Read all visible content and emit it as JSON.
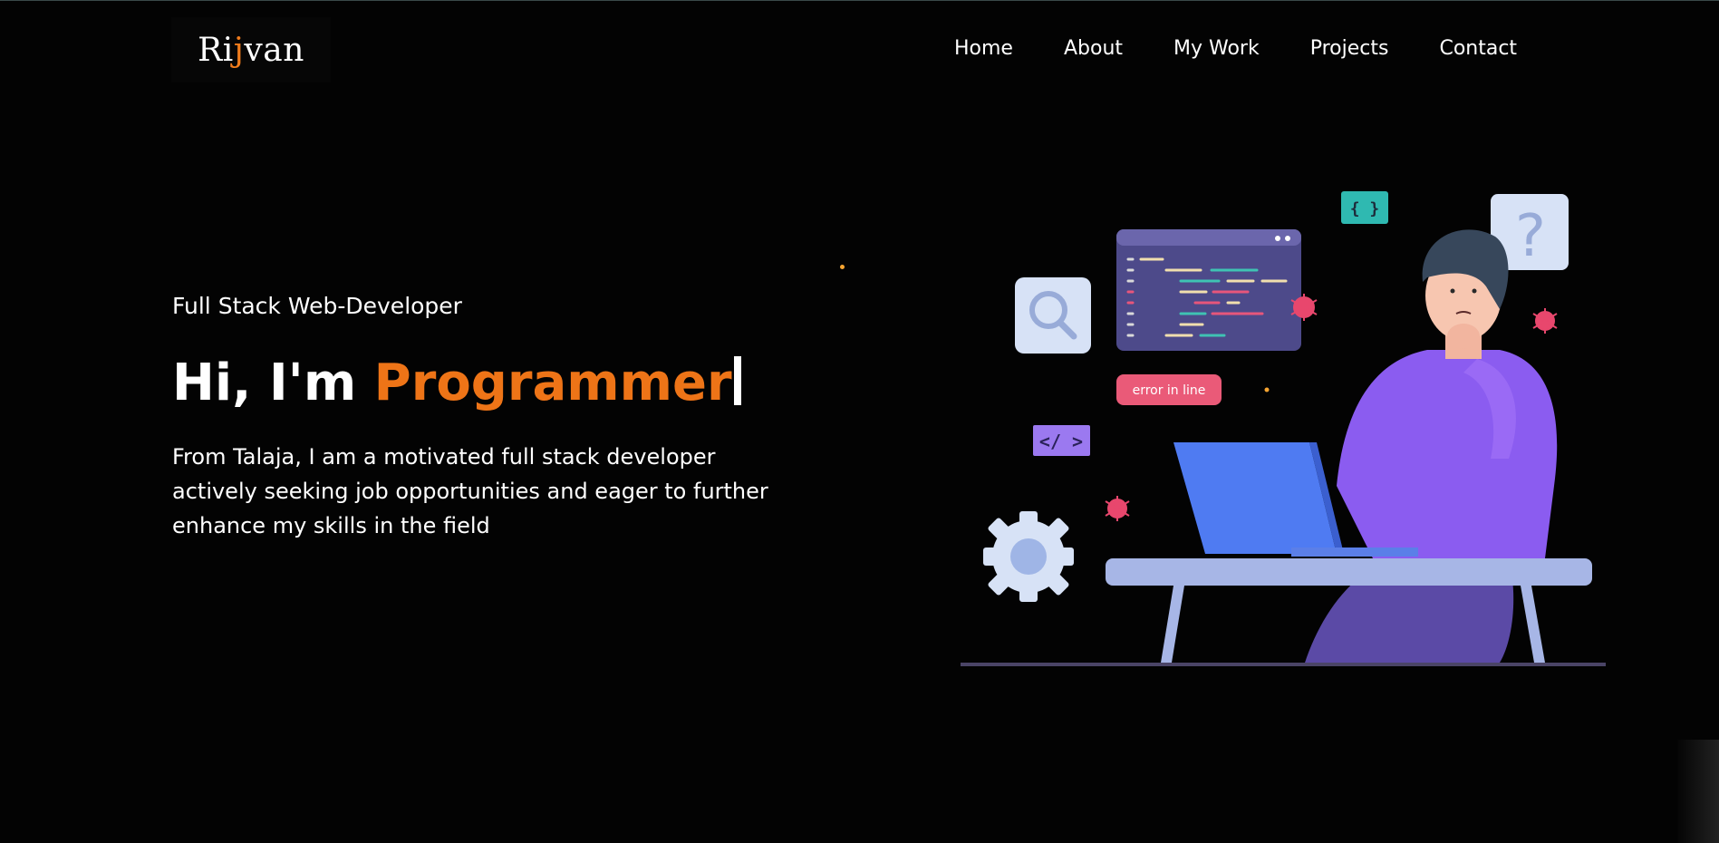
{
  "header": {
    "logo_prefix": "Ri",
    "logo_accent": "j",
    "logo_suffix": "van",
    "nav": [
      {
        "label": "Home"
      },
      {
        "label": "About"
      },
      {
        "label": "My Work"
      },
      {
        "label": "Projects"
      },
      {
        "label": "Contact"
      }
    ]
  },
  "hero": {
    "subtitle": "Full Stack Web-Developer",
    "greeting": "Hi, I'm ",
    "role": "Programmer",
    "description": "From Talaja, I am a motivated full stack developer actively seeking job opportunities and eager to further enhance my skills in the field"
  },
  "illustration": {
    "code_tag": "</ >",
    "braces_tag": "{ }",
    "question_mark": "?",
    "error_badge": "error in line"
  },
  "colors": {
    "background": "#030303",
    "accent": "#ee7417",
    "text": "#ffffff"
  }
}
